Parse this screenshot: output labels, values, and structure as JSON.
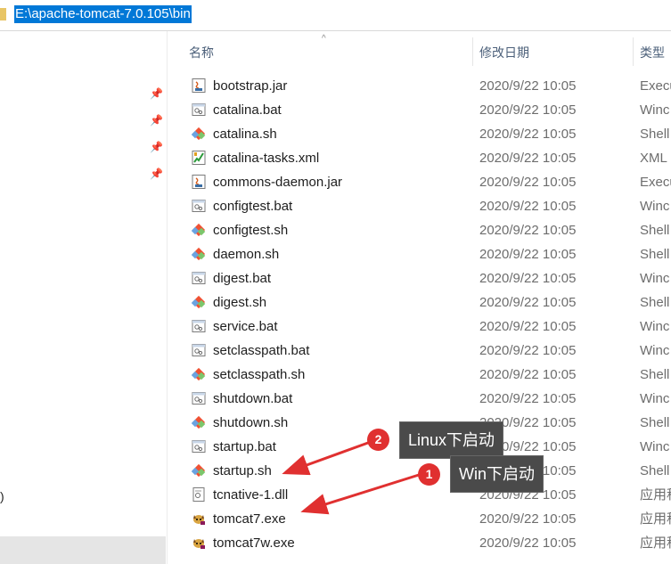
{
  "address_bar": {
    "path": "E:\\apache-tomcat-7.0.105\\bin"
  },
  "columns": {
    "name": "名称",
    "date": "修改日期",
    "type": "类型"
  },
  "nav": {
    "partial_text": ")"
  },
  "files": [
    {
      "name": "bootstrap.jar",
      "date": "2020/9/22 10:05",
      "type": "Execu",
      "icon": "java-jar-icon"
    },
    {
      "name": "catalina.bat",
      "date": "2020/9/22 10:05",
      "type": "Winc",
      "icon": "batch-file-icon"
    },
    {
      "name": "catalina.sh",
      "date": "2020/9/22 10:05",
      "type": "Shell",
      "icon": "shell-script-icon"
    },
    {
      "name": "catalina-tasks.xml",
      "date": "2020/9/22 10:05",
      "type": "XML",
      "icon": "xml-file-icon"
    },
    {
      "name": "commons-daemon.jar",
      "date": "2020/9/22 10:05",
      "type": "Execu",
      "icon": "java-jar-icon"
    },
    {
      "name": "configtest.bat",
      "date": "2020/9/22 10:05",
      "type": "Winc",
      "icon": "batch-file-icon"
    },
    {
      "name": "configtest.sh",
      "date": "2020/9/22 10:05",
      "type": "Shell",
      "icon": "shell-script-icon"
    },
    {
      "name": "daemon.sh",
      "date": "2020/9/22 10:05",
      "type": "Shell",
      "icon": "shell-script-icon"
    },
    {
      "name": "digest.bat",
      "date": "2020/9/22 10:05",
      "type": "Winc",
      "icon": "batch-file-icon"
    },
    {
      "name": "digest.sh",
      "date": "2020/9/22 10:05",
      "type": "Shell",
      "icon": "shell-script-icon"
    },
    {
      "name": "service.bat",
      "date": "2020/9/22 10:05",
      "type": "Winc",
      "icon": "batch-file-icon"
    },
    {
      "name": "setclasspath.bat",
      "date": "2020/9/22 10:05",
      "type": "Winc",
      "icon": "batch-file-icon"
    },
    {
      "name": "setclasspath.sh",
      "date": "2020/9/22 10:05",
      "type": "Shell",
      "icon": "shell-script-icon"
    },
    {
      "name": "shutdown.bat",
      "date": "2020/9/22 10:05",
      "type": "Winc",
      "icon": "batch-file-icon"
    },
    {
      "name": "shutdown.sh",
      "date": "2020/9/22 10:05",
      "type": "Shell",
      "icon": "shell-script-icon"
    },
    {
      "name": "startup.bat",
      "date": "2020/9/22 10:05",
      "type": "Winc",
      "icon": "batch-file-icon"
    },
    {
      "name": "startup.sh",
      "date": "2020/9/22 10:05",
      "type": "Shell",
      "icon": "shell-script-icon"
    },
    {
      "name": "tcnative-1.dll",
      "date": "2020/9/22 10:05",
      "type": "应用程",
      "icon": "dll-file-icon"
    },
    {
      "name": "tomcat7.exe",
      "date": "2020/9/22 10:05",
      "type": "应用程",
      "icon": "tomcat-exe-icon"
    },
    {
      "name": "tomcat7w.exe",
      "date": "2020/9/22 10:05",
      "type": "应用程",
      "icon": "tomcat-exe-icon"
    }
  ],
  "annotations": [
    {
      "number": "2",
      "label": "Linux下启动",
      "color": "#e03030"
    },
    {
      "number": "1",
      "label": "Win下启动",
      "color": "#e03030"
    }
  ],
  "colors": {
    "selection": "#0078d7",
    "arrow": "#e03030",
    "callout_bg": "#4a4a4a"
  }
}
